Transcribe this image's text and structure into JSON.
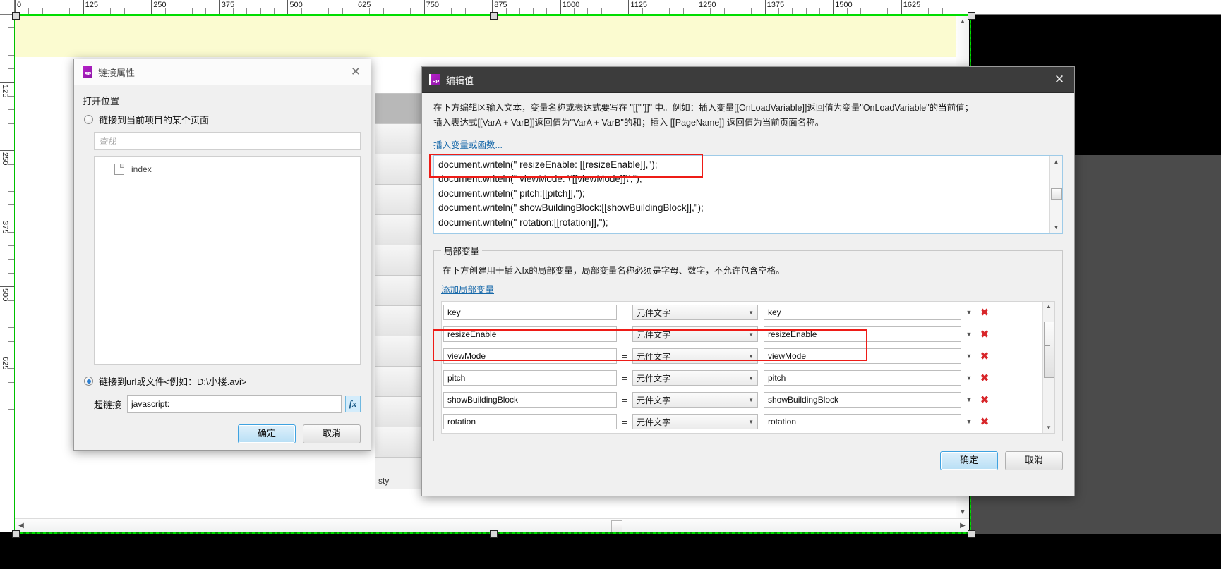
{
  "app": {
    "ruler": {
      "h_labels": [
        "0",
        "125",
        "250",
        "375",
        "500",
        "625",
        "750",
        "875",
        "1000",
        "1125",
        "1250",
        "1375",
        "1500",
        "1625"
      ],
      "v_labels": [
        "125",
        "250",
        "375",
        "500",
        "625"
      ]
    },
    "bg_panel_label": "sty"
  },
  "link_dialog": {
    "title": "链接属性",
    "logo": "RP",
    "close_icon": "close-icon",
    "section_title": "打开位置",
    "radio_page": {
      "label": "链接到当前项目的某个页面",
      "checked": false
    },
    "search_placeholder": "查找",
    "tree_items": [
      {
        "label": "index",
        "icon": "page-icon"
      }
    ],
    "radio_url": {
      "label": "链接到url或文件<例如：D:\\小楼.avi>",
      "checked": true
    },
    "hyperlink_label": "超链接",
    "hyperlink_value": "javascript:",
    "fx_label": "fx",
    "ok_label": "确定",
    "cancel_label": "取消"
  },
  "edit_dialog": {
    "title": "编辑值",
    "logo": "RP",
    "close_icon": "close-icon",
    "description_line1": "在下方编辑区输入文本，变量名称或表达式要写在 \"[[\"\"]]\" 中。例如：插入变量[[OnLoadVariable]]返回值为变量\"OnLoadVariable\"的当前值；",
    "description_line2": "插入表达式[[VarA + VarB]]返回值为\"VarA + VarB\"的和；插入 [[PageName]] 返回值为当前页面名称。",
    "insert_link": "插入变量或函数...",
    "code_lines": [
      "document.writeln(\" resizeEnable: [[resizeEnable]],\");",
      "document.writeln(\"  viewMode: \\'[[viewMode]]\\',\");",
      "document.writeln(\"  pitch:[[pitch]],\");",
      "document.writeln(\"  showBuildingBlock:[[showBuildingBlock]],\");",
      "document.writeln(\"  rotation:[[rotation]],\");",
      "document.writeln(\"  zoomEnable:[[zoomEnable]],\");"
    ],
    "local_vars": {
      "legend": "局部变量",
      "description": "在下方创建用于插入fx的局部变量，局部变量名称必须是字母、数字，不允许包含空格。",
      "add_link": "添加局部变量",
      "eq_symbol": "=",
      "delete_icon": "delete-icon",
      "rows": [
        {
          "name": "key",
          "type": "元件文字",
          "value": "key"
        },
        {
          "name": "resizeEnable",
          "type": "元件文字",
          "value": "resizeEnable"
        },
        {
          "name": "viewMode",
          "type": "元件文字",
          "value": "viewMode"
        },
        {
          "name": "pitch",
          "type": "元件文字",
          "value": "pitch"
        },
        {
          "name": "showBuildingBlock",
          "type": "元件文字",
          "value": "showBuildingBlock"
        },
        {
          "name": "rotation",
          "type": "元件文字",
          "value": "rotation"
        }
      ]
    },
    "ok_label": "确定",
    "cancel_label": "取消"
  },
  "annotations": {
    "highlight_color": "#ee1c17",
    "boxes": [
      "code-first-line",
      "variable-row-resizeEnable"
    ]
  }
}
